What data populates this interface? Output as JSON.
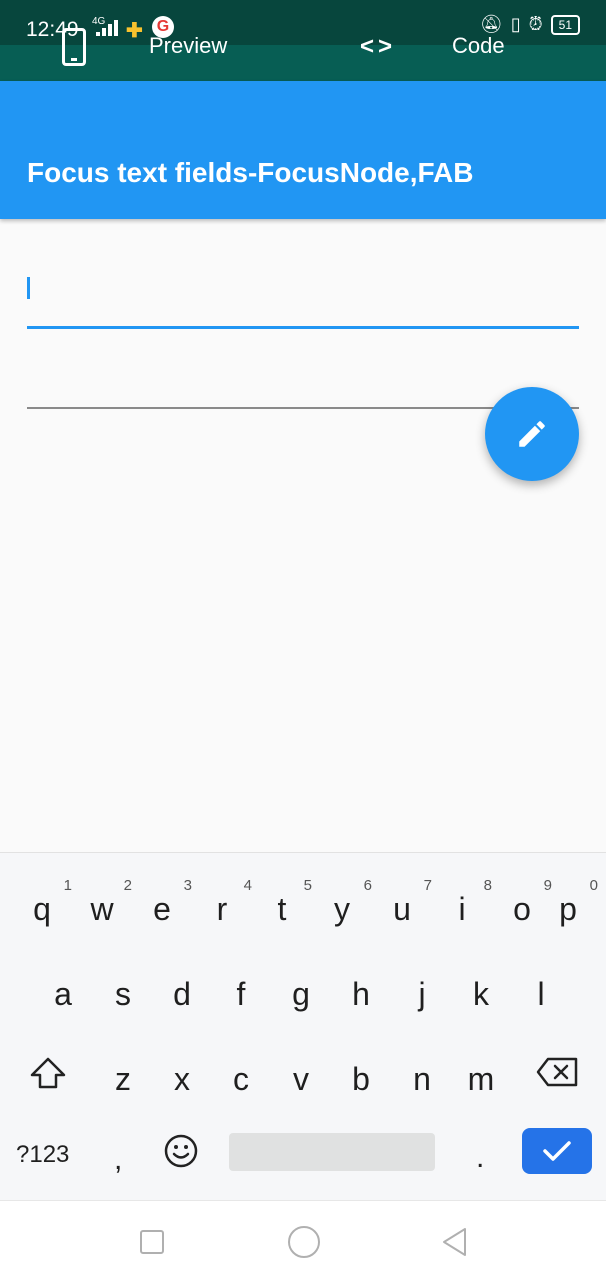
{
  "status_bar": {
    "time": "12:49",
    "network": "4G",
    "battery": "51"
  },
  "tool_bar": {
    "preview_label": "Preview",
    "code_label": "Code",
    "code_icon": "<>"
  },
  "app_bar": {
    "title": "Focus text fields-FocusNode,FAB"
  },
  "fields": {
    "first": {
      "value": "",
      "focused": true
    },
    "second": {
      "value": "",
      "focused": false
    }
  },
  "fab": {
    "icon": "edit-icon"
  },
  "keyboard": {
    "row1": [
      {
        "key": "q",
        "hint": "1"
      },
      {
        "key": "w",
        "hint": "2"
      },
      {
        "key": "e",
        "hint": "3"
      },
      {
        "key": "r",
        "hint": "4"
      },
      {
        "key": "t",
        "hint": "5"
      },
      {
        "key": "y",
        "hint": "6"
      },
      {
        "key": "u",
        "hint": "7"
      },
      {
        "key": "i",
        "hint": "8"
      },
      {
        "key": "o",
        "hint": "9"
      },
      {
        "key": "p",
        "hint": "0"
      }
    ],
    "row2": [
      "a",
      "s",
      "d",
      "f",
      "g",
      "h",
      "j",
      "k",
      "l"
    ],
    "row3": [
      "z",
      "x",
      "c",
      "v",
      "b",
      "n",
      "m"
    ],
    "symbols_label": "?123",
    "comma": ",",
    "period": "."
  },
  "colors": {
    "accent": "#2196f3",
    "status_bar": "#07463d",
    "enter_key": "#2573e8"
  }
}
